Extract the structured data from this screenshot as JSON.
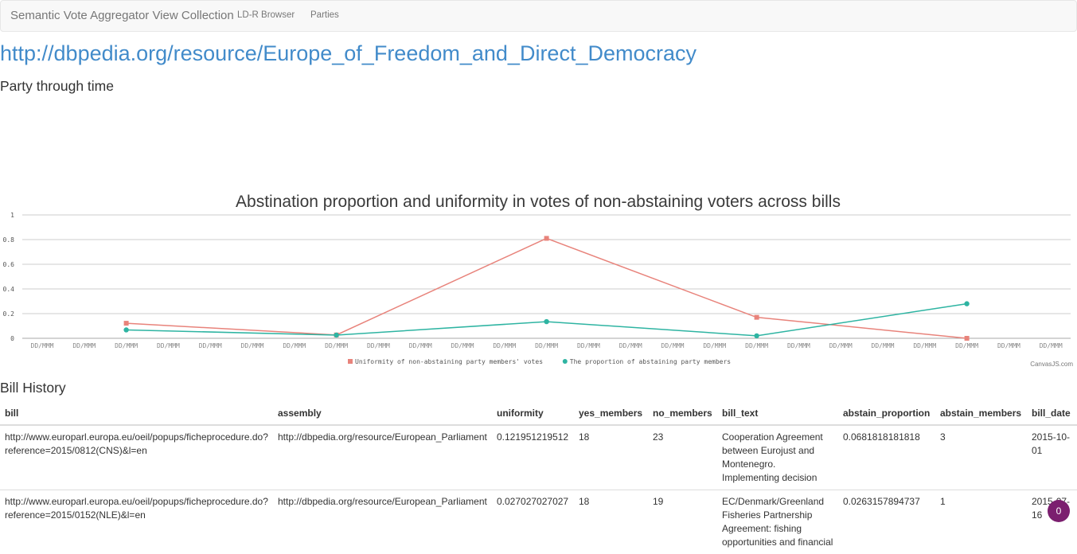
{
  "navbar": {
    "brand": "Semantic Vote Aggregator View Collection",
    "links": [
      "LD-R Browser",
      "Parties"
    ]
  },
  "page_title": "http://dbpedia.org/resource/Europe_of_Freedom_and_Direct_Democracy",
  "section_party": "Party through time",
  "chart_credit": "CanvasJS.com",
  "chart_data": {
    "type": "line",
    "title": "Abstination proportion and uniformity in votes of non-abstaining voters across bills",
    "x_tick_labels": [
      "DD/MMM",
      "DD/MMM",
      "DD/MMM",
      "DD/MMM",
      "DD/MMM",
      "DD/MMM",
      "DD/MMM",
      "DD/MMM",
      "DD/MMM",
      "DD/MMM",
      "DD/MMM",
      "DD/MMM",
      "DD/MMM",
      "DD/MMM",
      "DD/MMM",
      "DD/MMM",
      "DD/MMM",
      "DD/MMM",
      "DD/MMM",
      "DD/MMM",
      "DD/MMM",
      "DD/MMM",
      "DD/MMM",
      "DD/MMM",
      "DD/MMM",
      "DD/MMM"
    ],
    "y_ticks": [
      "0",
      "0.2",
      "0.4",
      "0.6",
      "0.8",
      "1"
    ],
    "ylim": [
      0,
      1
    ],
    "grid": true,
    "legend_position": "bottom",
    "series": [
      {
        "name": "Uniformity of non-abstaining party members' votes",
        "color": "#e8837b",
        "marker": "square",
        "points": [
          [
            2,
            0.122
          ],
          [
            7,
            0.027
          ],
          [
            12,
            0.81
          ],
          [
            17,
            0.17
          ],
          [
            22,
            0.0
          ]
        ]
      },
      {
        "name": "The proportion of abstaining party members",
        "color": "#2eb4a2",
        "marker": "circle",
        "points": [
          [
            2,
            0.068
          ],
          [
            7,
            0.026
          ],
          [
            12,
            0.135
          ],
          [
            17,
            0.02
          ],
          [
            22,
            0.28
          ]
        ]
      }
    ]
  },
  "section_bills": "Bill History",
  "bill_table": {
    "columns": [
      "bill",
      "assembly",
      "uniformity",
      "yes_members",
      "no_members",
      "bill_text",
      "abstain_proportion",
      "abstain_members",
      "bill_date"
    ],
    "rows": [
      [
        "http://www.europarl.europa.eu/oeil/popups/ficheprocedure.do?reference=2015/0812(CNS)&l=en",
        "http://dbpedia.org/resource/European_Parliament",
        "0.121951219512",
        "18",
        "23",
        "Cooperation Agreement between Eurojust and Montenegro. Implementing decision",
        "0.0681818181818",
        "3",
        "2015-10-01"
      ],
      [
        "http://www.europarl.europa.eu/oeil/popups/ficheprocedure.do?reference=2015/0152(NLE)&l=en",
        "http://dbpedia.org/resource/European_Parliament",
        "0.027027027027",
        "18",
        "19",
        "EC/Denmark/Greenland Fisheries Partnership Agreement: fishing opportunities and financial",
        "0.0263157894737",
        "1",
        "2015-07-16"
      ]
    ]
  },
  "notification_badge": "0"
}
